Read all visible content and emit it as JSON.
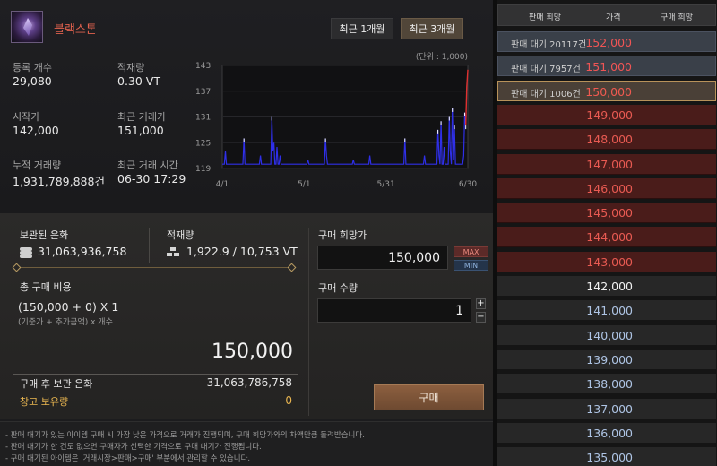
{
  "item": {
    "name": "블랙스톤",
    "icon": "black-stone-icon"
  },
  "period_tabs": [
    {
      "label": "최근 1개월",
      "active": false
    },
    {
      "label": "최근 3개월",
      "active": true
    }
  ],
  "stats": {
    "registered_label": "등록 개수",
    "registered_value": "29,080",
    "stock_label": "적재량",
    "stock_value": "0.30 VT",
    "start_label": "시작가",
    "start_value": "142,000",
    "recent_label": "최근 거래가",
    "recent_value": "151,000",
    "volume_label": "누적 거래량",
    "volume_value": "1,931,789,888건",
    "recent_time_label": "최근 거래 시간",
    "recent_time_value": "06-30 17:29"
  },
  "chart_data": {
    "type": "line",
    "unit_note": "(단위 : 1,000)",
    "y_ticks": [
      "143",
      "137",
      "131",
      "125",
      "119"
    ],
    "ylim": [
      119,
      143
    ],
    "x_ticks": [
      "4/1",
      "5/1",
      "5/31",
      "6/30"
    ],
    "series": [
      {
        "values": [
          120,
          120,
          120,
          123,
          120,
          120,
          120,
          120,
          120,
          120,
          120,
          120,
          120,
          120,
          120,
          120,
          120,
          120,
          120,
          120,
          120,
          126,
          120,
          120,
          120,
          120,
          120,
          120,
          120,
          120,
          120,
          120,
          120,
          120,
          120,
          120,
          120,
          122,
          120,
          120,
          120,
          120,
          120,
          120,
          120,
          120,
          120,
          120,
          131,
          123,
          125,
          120,
          120,
          124,
          120,
          120,
          122,
          120,
          120,
          120,
          120,
          120,
          120,
          120,
          120,
          120,
          120,
          120,
          120,
          120,
          120,
          120,
          120,
          120,
          120,
          120,
          120,
          120,
          120,
          120,
          120,
          120,
          120,
          121,
          120,
          120,
          120,
          120,
          120,
          120,
          120,
          120,
          120,
          120,
          120,
          120,
          120,
          120,
          120,
          120,
          126,
          122,
          120,
          120,
          120,
          120,
          120,
          120,
          120,
          120,
          120,
          120,
          120,
          120,
          120,
          120,
          120,
          120,
          120,
          120,
          120,
          120,
          120,
          120,
          120,
          120,
          120,
          121,
          120,
          120,
          120,
          120,
          120,
          120,
          120,
          120,
          120,
          120,
          120,
          120,
          120,
          120,
          120,
          122,
          120,
          120,
          120,
          120,
          120,
          120,
          120,
          120,
          120,
          120,
          120,
          120,
          120,
          120,
          120,
          120,
          120,
          120,
          120,
          120,
          120,
          120,
          120,
          120,
          120,
          120,
          120,
          120,
          120,
          120,
          120,
          120,
          120,
          126,
          120,
          120,
          120,
          120,
          120,
          120,
          120,
          120,
          120,
          120,
          120,
          120,
          120,
          120,
          120,
          120,
          120,
          120,
          122,
          120,
          120,
          120,
          120,
          120,
          120,
          120,
          120,
          120,
          120,
          120,
          120,
          128,
          122,
          120,
          130,
          120,
          120,
          124,
          120,
          120,
          120,
          120,
          131,
          123,
          120,
          133,
          121,
          129,
          120,
          120,
          120,
          120,
          120,
          120,
          120,
          120,
          122,
          132,
          129,
          138,
          142
        ]
      }
    ]
  },
  "purchase": {
    "silver_label": "보관된 은화",
    "silver_value": "31,063,936,758",
    "weight_label": "적재량",
    "weight_value": "1,922.9 / 10,753 VT",
    "total_cost_label": "총 구매 비용",
    "formula": "(150,000 + 0) X 1",
    "formula_note": "(기준가 + 추가금액) x 개수",
    "total_price": "150,000",
    "after_label": "구매 후 보관 은화",
    "after_value": "31,063,786,758",
    "warehouse_label": "창고 보유량",
    "warehouse_value": "0",
    "desired_price_label": "구매 희망가",
    "desired_price_value": "150,000",
    "max_label": "MAX",
    "min_label": "MIN",
    "quantity_label": "구매 수량",
    "quantity_value": "1",
    "plus_label": "+",
    "minus_label": "−",
    "buy_label": "구매"
  },
  "notes": [
    "- 판매 대기가 있는 아이템 구매 시 가장 낮은 가격으로 거래가 진행되며, 구매 희망가와의 차액만큼 돌려받습니다.",
    "- 판매 대기가 한 건도 없으면 구매자가 선택한 가격으로 구매 대기가 진행됩니다.",
    "- 구매 대기된 아이템은 '거래시장>판매>구매' 부분에서 관리할 수 있습니다."
  ],
  "order_book": {
    "headers": [
      "판매 희망",
      "가격",
      "구매 희망"
    ],
    "rows": [
      {
        "wait": "판매 대기 20117건",
        "price": "152,000",
        "style": "row-blue"
      },
      {
        "wait": "판매 대기 7957건",
        "price": "151,000",
        "style": "row-blue"
      },
      {
        "wait": "판매 대기 1006건",
        "price": "150,000",
        "style": "row-selected"
      },
      {
        "wait": "",
        "price": "149,000",
        "style": "row-red"
      },
      {
        "wait": "",
        "price": "148,000",
        "style": "row-red"
      },
      {
        "wait": "",
        "price": "147,000",
        "style": "row-red"
      },
      {
        "wait": "",
        "price": "146,000",
        "style": "row-red"
      },
      {
        "wait": "",
        "price": "145,000",
        "style": "row-red"
      },
      {
        "wait": "",
        "price": "144,000",
        "style": "row-red"
      },
      {
        "wait": "",
        "price": "143,000",
        "style": "row-red"
      },
      {
        "wait": "",
        "price": "142,000",
        "style": "row-dark row-current"
      },
      {
        "wait": "",
        "price": "141,000",
        "style": "row-dark row-blue-price"
      },
      {
        "wait": "",
        "price": "140,000",
        "style": "row-dark row-blue-price"
      },
      {
        "wait": "",
        "price": "139,000",
        "style": "row-dark row-blue-price"
      },
      {
        "wait": "",
        "price": "138,000",
        "style": "row-dark row-blue-price"
      },
      {
        "wait": "",
        "price": "137,000",
        "style": "row-dark row-blue-price"
      },
      {
        "wait": "",
        "price": "136,000",
        "style": "row-dark row-blue-price"
      },
      {
        "wait": "",
        "price": "135,000",
        "style": "row-dark row-blue-price"
      }
    ]
  },
  "colors": {
    "line": "#2f2fe8",
    "spike": "#e03030",
    "peak": "#ffffff"
  }
}
